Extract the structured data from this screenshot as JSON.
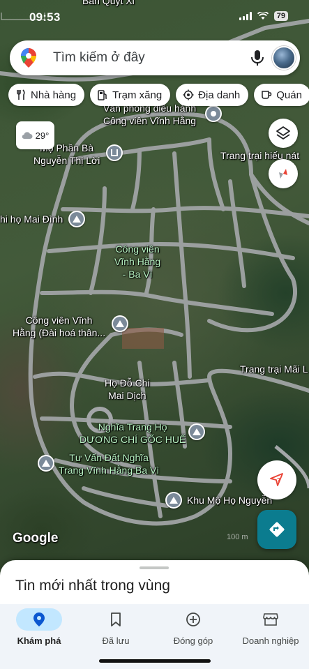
{
  "status": {
    "time": "09:53",
    "battery": "79"
  },
  "search": {
    "placeholder": "Tìm kiếm ở đây"
  },
  "chips": [
    {
      "label": "Nhà hàng",
      "icon": "fork-knife-icon"
    },
    {
      "label": "Trạm xăng",
      "icon": "gas-pump-icon"
    },
    {
      "label": "Địa danh",
      "icon": "landmark-icon"
    },
    {
      "label": "Quán",
      "icon": "coffee-cup-icon"
    }
  ],
  "weather": {
    "temp": "29°",
    "icon": "cloud-icon"
  },
  "map_labels": {
    "top_partial": "Bản Quýt Xi",
    "office": "Văn phòng điều hành\nCông viên Vĩnh Hằng",
    "farm_top": "Trang trại hiếu nát",
    "tomb": "Mộ Phần Bà\nNguyễn Thị Lời",
    "mai_dinh": "hi họ Mai Đình",
    "park_center": "Công viên\nVĩnh Hằng\n- Ba Vì",
    "park_crem": "Công viên Vĩnh\nHằng (Đài hoá thân...",
    "farm_right": "Trang trại Mãi L",
    "do_chi": "Họ Đỗ Chi\nMai Dịch",
    "nghia_trang": "Nghĩa Trang Họ\nDƯƠNG CHÍ GỐC HUẾ",
    "tu_van": "Tư Vấn Đất Nghĩa\nTrang Vĩnh Hằng Ba Vì",
    "khu_mo": "Khu Mộ Họ Nguyễn"
  },
  "map": {
    "attribution": "Google",
    "scale": "100 m"
  },
  "sheet": {
    "title": "Tin mới nhất trong vùng"
  },
  "nav": [
    {
      "label": "Khám phá",
      "icon": "location-pin-icon",
      "active": true
    },
    {
      "label": "Đã lưu",
      "icon": "bookmark-icon",
      "active": false
    },
    {
      "label": "Đóng góp",
      "icon": "add-circle-icon",
      "active": false
    },
    {
      "label": "Doanh nghiệp",
      "icon": "storefront-icon",
      "active": false
    }
  ],
  "colors": {
    "accent": "#0b7c8f",
    "nav_active": "#c2e7ff",
    "road": "#a7a9ab"
  }
}
